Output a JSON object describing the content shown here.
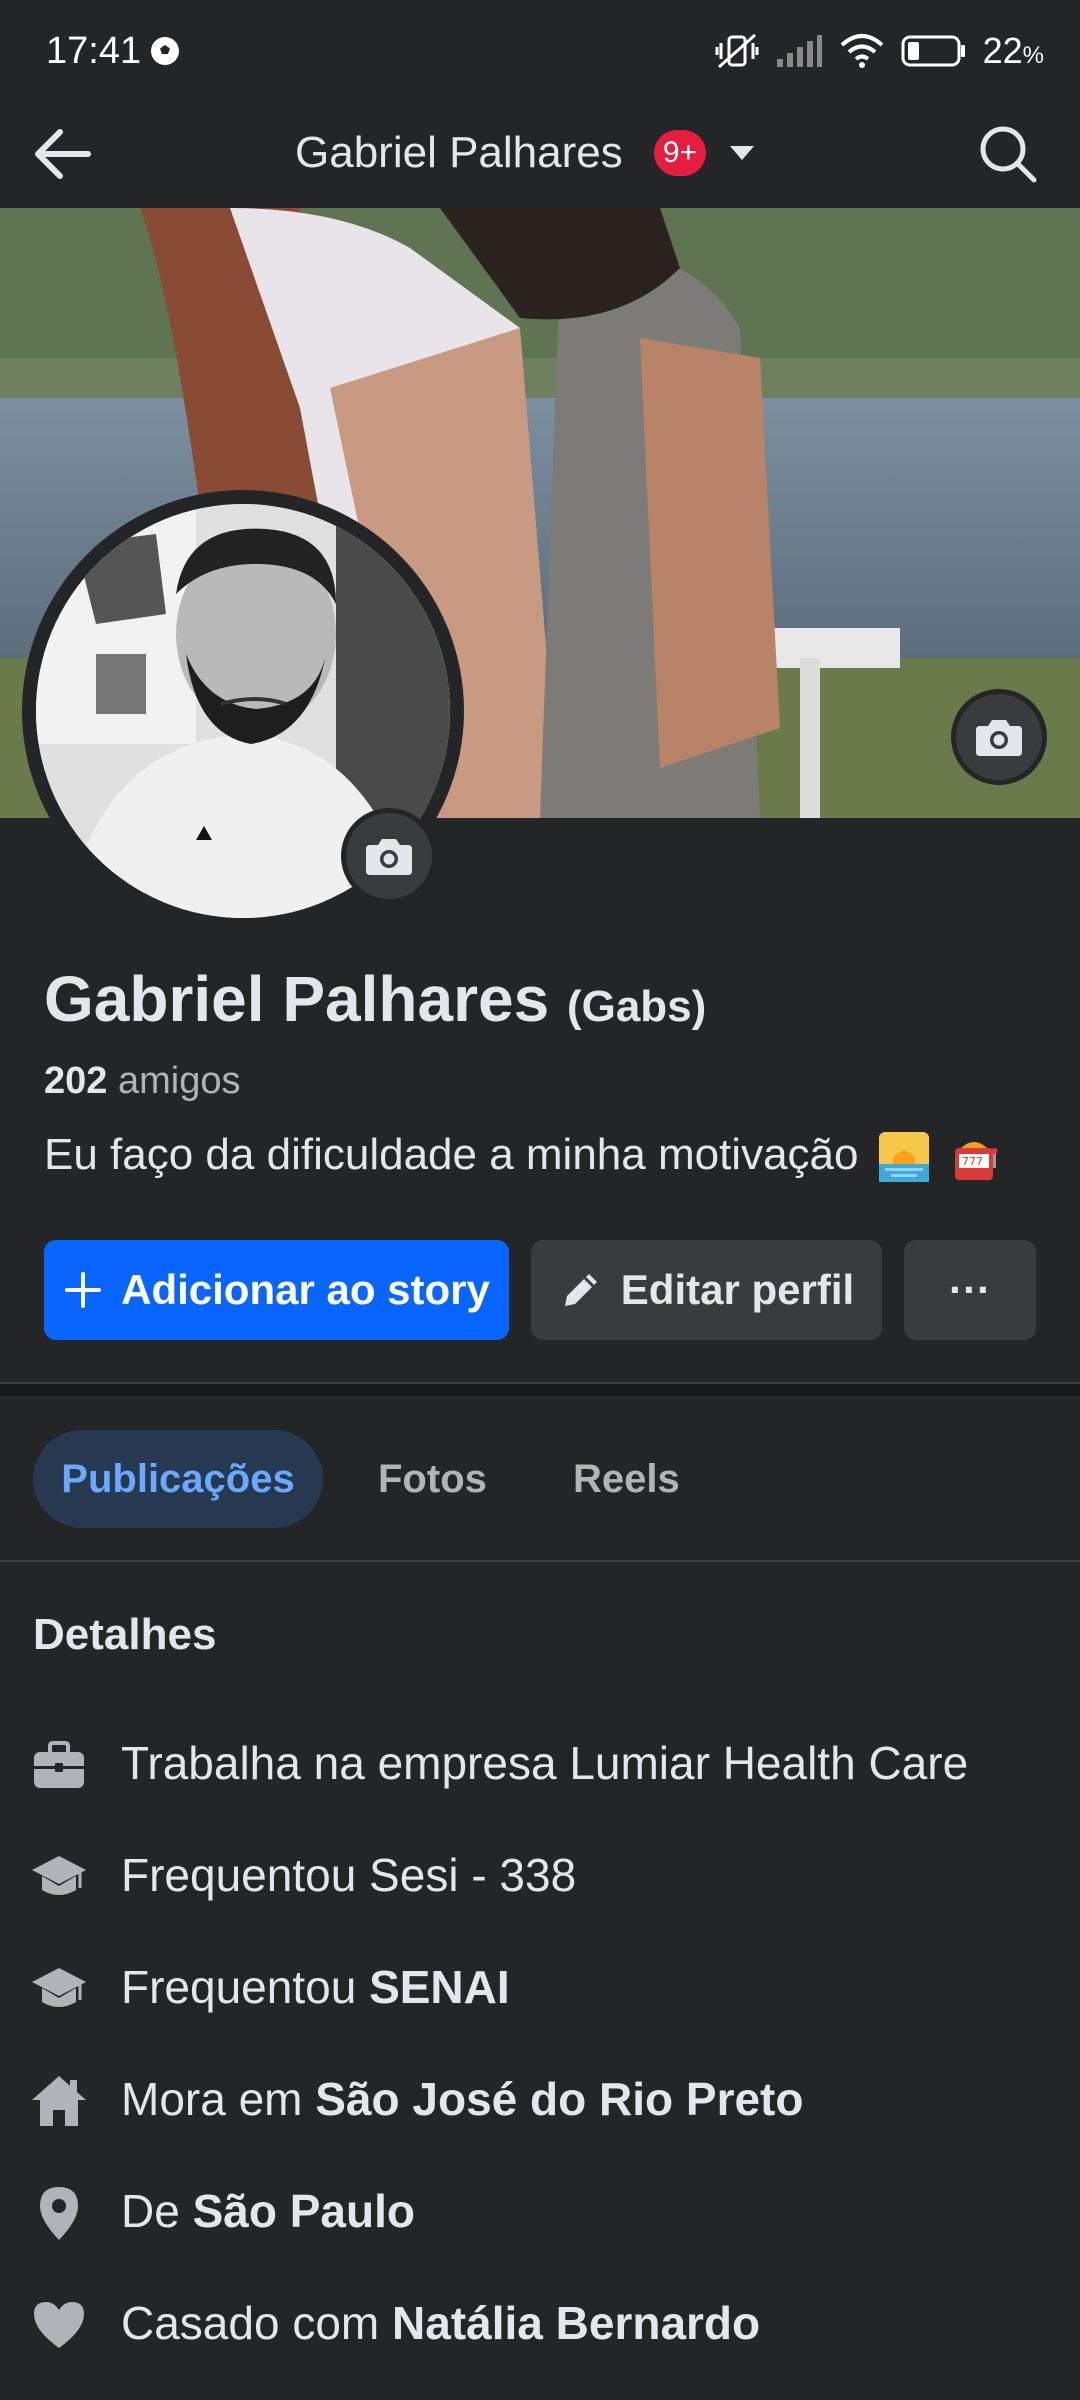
{
  "status_bar": {
    "time": "17:41",
    "battery_percent": "22",
    "battery_unit": "%"
  },
  "nav": {
    "title": "Gabriel Palhares",
    "badge": "9+",
    "icons": [
      "arrow-left-icon",
      "chevron-down-icon",
      "search-icon"
    ]
  },
  "profile": {
    "name": "Gabriel Palhares",
    "nickname": "(Gabs)",
    "friends_count": "202",
    "friends_label": "amigos",
    "bio": "Eu faço da dificuldade a minha motivação"
  },
  "actions": {
    "add_story": "Adicionar ao story",
    "edit_profile": "Editar perfil",
    "more": "···"
  },
  "tabs": [
    {
      "label": "Publicações",
      "active": true
    },
    {
      "label": "Fotos",
      "active": false
    },
    {
      "label": "Reels",
      "active": false
    }
  ],
  "details": {
    "title": "Detalhes",
    "items": [
      {
        "icon": "briefcase-icon",
        "prefix": "Trabalha na empresa Lumiar Health Care",
        "bold": ""
      },
      {
        "icon": "graduation-cap-icon",
        "prefix": "Frequentou Sesi - 338",
        "bold": ""
      },
      {
        "icon": "graduation-cap-icon",
        "prefix": "Frequentou ",
        "bold": "SENAI"
      },
      {
        "icon": "home-icon",
        "prefix": "Mora em ",
        "bold": "São José do Rio Preto"
      },
      {
        "icon": "location-pin-icon",
        "prefix": "De ",
        "bold": "São Paulo"
      },
      {
        "icon": "heart-icon",
        "prefix": "Casado com ",
        "bold": "Natália Bernardo"
      }
    ]
  },
  "colors": {
    "background": "#242526",
    "primary_button": "#0866ff",
    "secondary_button": "#3a3b3c",
    "active_tab_bg": "#263951",
    "active_tab_text": "#6aa9ff",
    "badge": "#e41e3f"
  }
}
